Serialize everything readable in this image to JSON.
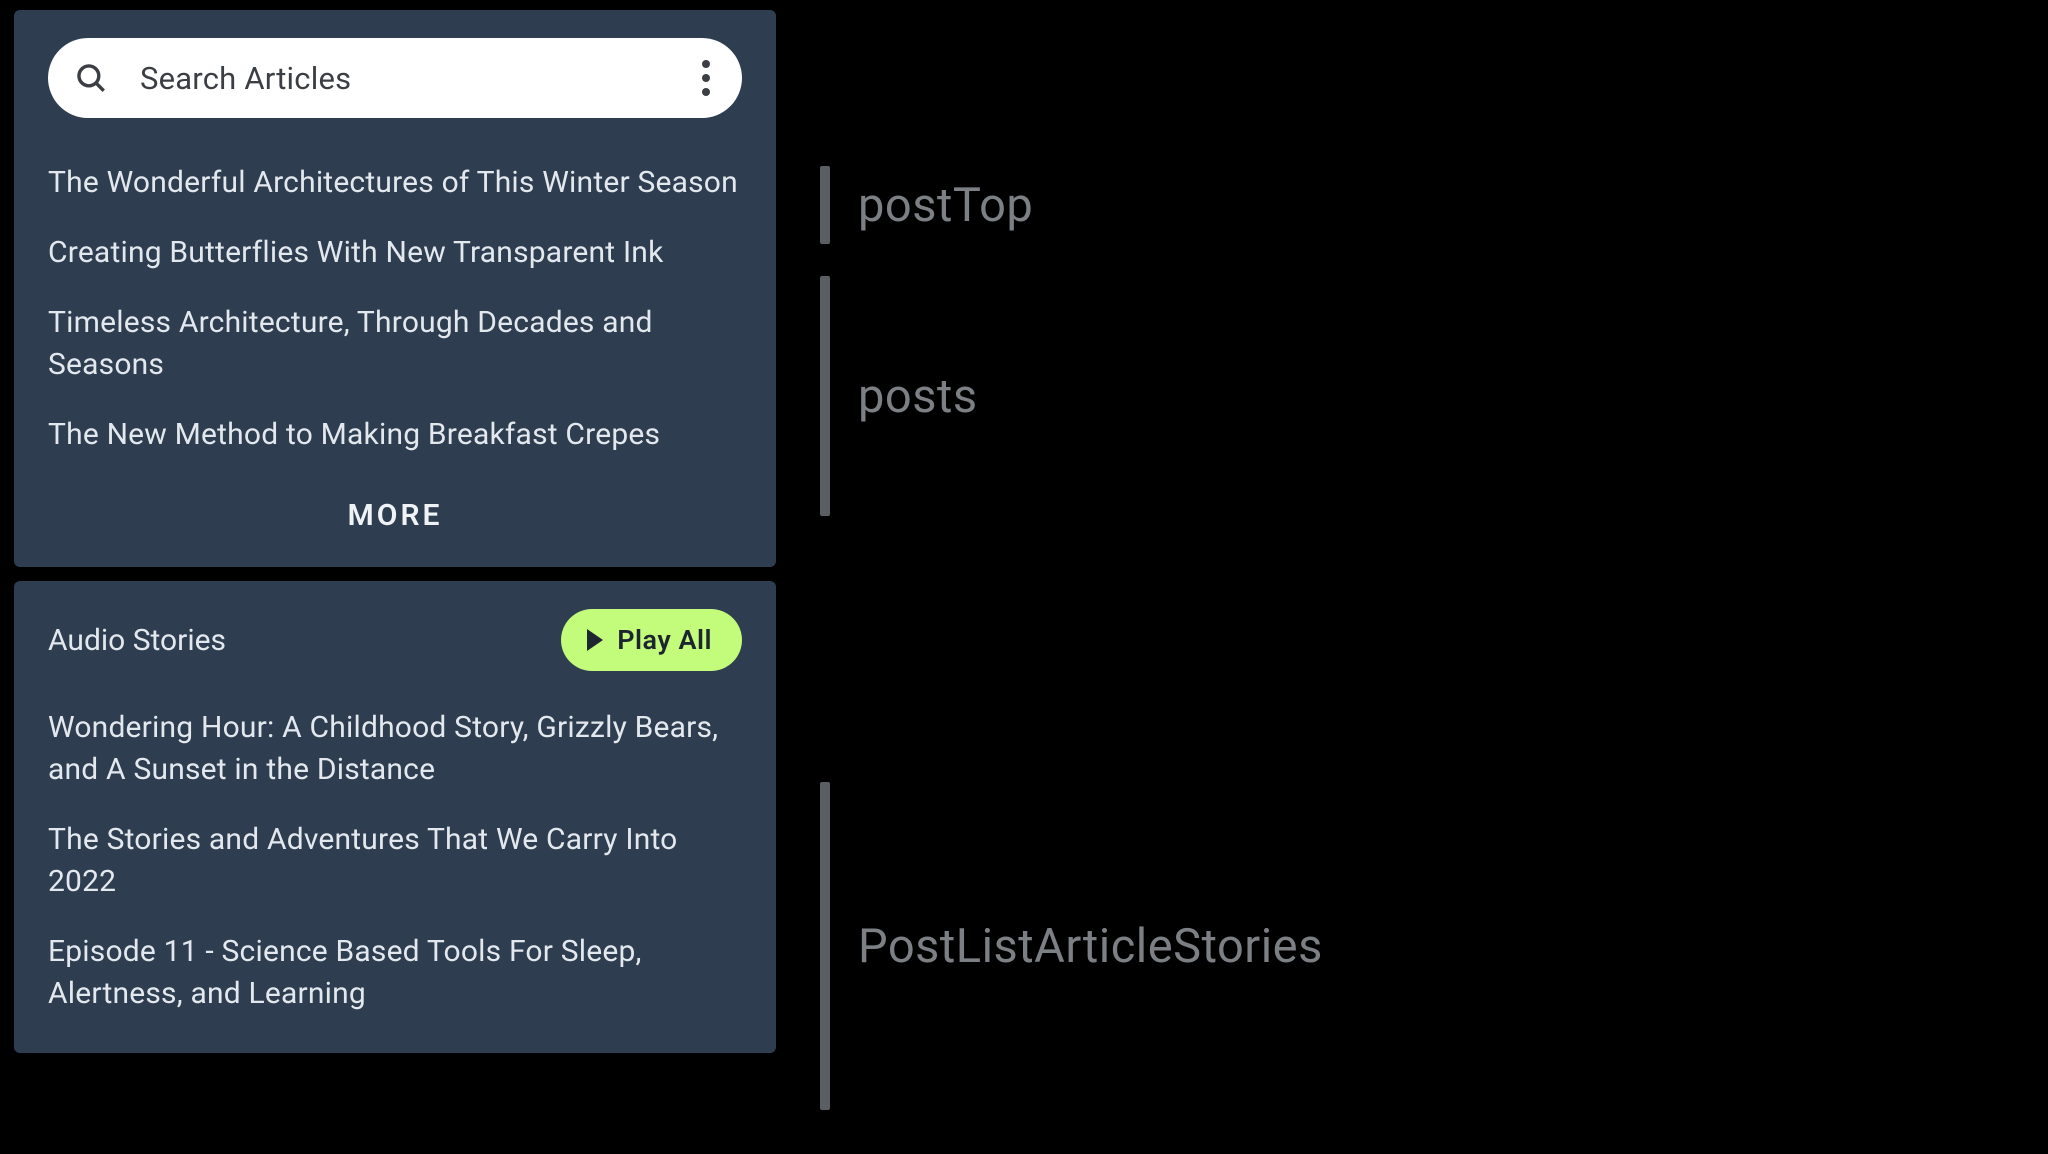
{
  "search": {
    "placeholder": "Search Articles"
  },
  "posts_card": {
    "items": [
      "The Wonderful Architectures of This Winter Season",
      "Creating Butterflies With New Transparent Ink",
      "Timeless Architecture, Through Decades and Seasons",
      "The New Method to Making Breakfast Crepes"
    ],
    "more_label": "MORE"
  },
  "audio_card": {
    "title": "Audio Stories",
    "play_all_label": "Play All",
    "items": [
      "Wondering Hour: A Childhood Story, Grizzly Bears, and A Sunset in the Distance",
      "The Stories and Adventures That We Carry Into 2022",
      "Episode 11 - Science Based Tools For Sleep, Alertness, and Learning"
    ]
  },
  "annotations": {
    "postTop": "postTop",
    "posts": "posts",
    "postListArticleStories": "PostListArticleStories"
  }
}
